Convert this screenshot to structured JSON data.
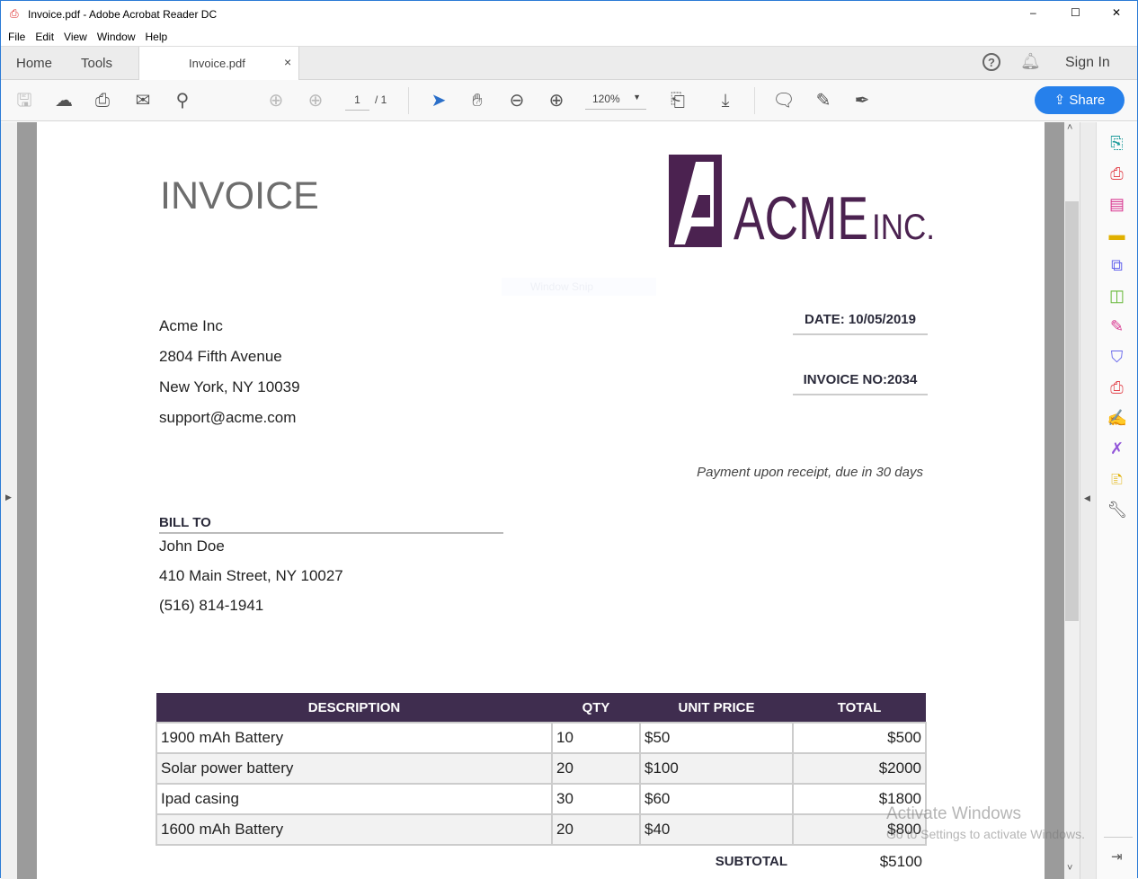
{
  "window": {
    "title": "Invoice.pdf - Adobe Acrobat Reader DC",
    "minimize": "–",
    "maximize": "☐",
    "close": "✕"
  },
  "menu": [
    "File",
    "Edit",
    "View",
    "Window",
    "Help"
  ],
  "tabs": {
    "home": "Home",
    "tools": "Tools",
    "doc": "Invoice.pdf",
    "close": "×",
    "sign_in": "Sign In"
  },
  "toolbar": {
    "page_current": "1",
    "page_total": "/ 1",
    "zoom": "120%",
    "share": "Share"
  },
  "invoice": {
    "heading": "INVOICE",
    "logo_text": "ACME INC.",
    "watermark": "Window Snip",
    "company": [
      "Acme Inc",
      "2804 Fifth Avenue",
      "New York, NY 10039",
      "support@acme.com"
    ],
    "date": "DATE: 10/05/2019",
    "invoice_no": "INVOICE NO:2034",
    "terms": "Payment upon receipt, due in 30 days",
    "bill_to_label": "BILL TO",
    "bill_to": [
      "John Doe",
      "410 Main Street, NY 10027",
      "(516) 814-1941"
    ],
    "columns": [
      "DESCRIPTION",
      "QTY",
      "UNIT PRICE",
      "TOTAL"
    ],
    "rows": [
      [
        "1900 mAh Battery",
        "10",
        "$50",
        "$500"
      ],
      [
        "Solar power battery",
        "20",
        "$100",
        "$2000"
      ],
      [
        "Ipad casing",
        "30",
        "$60",
        "$1800"
      ],
      [
        "1600 mAh Battery",
        "20",
        "$40",
        "$800"
      ]
    ],
    "subtotal_label": "SUBTOTAL",
    "subtotal": "$5100"
  },
  "activation": {
    "line1": "Activate Windows",
    "line2": "Go to Settings to activate Windows."
  },
  "colors": {
    "accent": "#2680eb",
    "brand": "#4b2250",
    "table_header": "#3f2d4f"
  }
}
